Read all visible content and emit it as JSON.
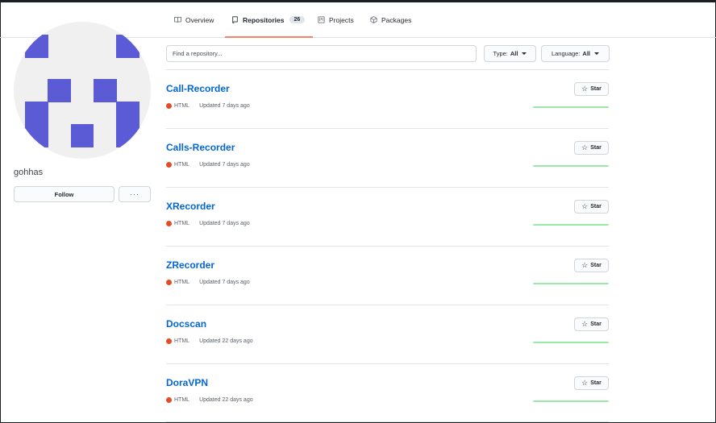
{
  "tabs": [
    {
      "label": "Overview",
      "icon": "book-icon"
    },
    {
      "label": "Repositories",
      "icon": "repo-icon",
      "count": "26"
    },
    {
      "label": "Projects",
      "icon": "project-icon"
    },
    {
      "label": "Packages",
      "icon": "package-icon"
    }
  ],
  "profile": {
    "username": "gohhas",
    "follow_label": "Follow",
    "more_label": "···",
    "avatar_color": "#5b5bd6"
  },
  "filters": {
    "search_placeholder": "Find a repository...",
    "type_label": "Type:",
    "type_value": "All",
    "language_label": "Language:",
    "language_value": "All"
  },
  "repos": [
    {
      "name": "Call-Recorder",
      "language": "HTML",
      "language_color": "#e34c26",
      "updated": "Updated 7 days ago",
      "star_label": "Star"
    },
    {
      "name": "Calls-Recorder",
      "language": "HTML",
      "language_color": "#e34c26",
      "updated": "Updated 7 days ago",
      "star_label": "Star"
    },
    {
      "name": "XRecorder",
      "language": "HTML",
      "language_color": "#e34c26",
      "updated": "Updated 7 days ago",
      "star_label": "Star"
    },
    {
      "name": "ZRecorder",
      "language": "HTML",
      "language_color": "#e34c26",
      "updated": "Updated 7 days ago",
      "star_label": "Star"
    },
    {
      "name": "Docscan",
      "language": "HTML",
      "language_color": "#e34c26",
      "updated": "Updated 22 days ago",
      "star_label": "Star"
    },
    {
      "name": "DoraVPN",
      "language": "HTML",
      "language_color": "#e34c26",
      "updated": "Updated 22 days ago",
      "star_label": "Star"
    }
  ],
  "colors": {
    "accent_underline": "#f9826c",
    "link": "#0366d6",
    "sparkline": "#9be9a8"
  }
}
